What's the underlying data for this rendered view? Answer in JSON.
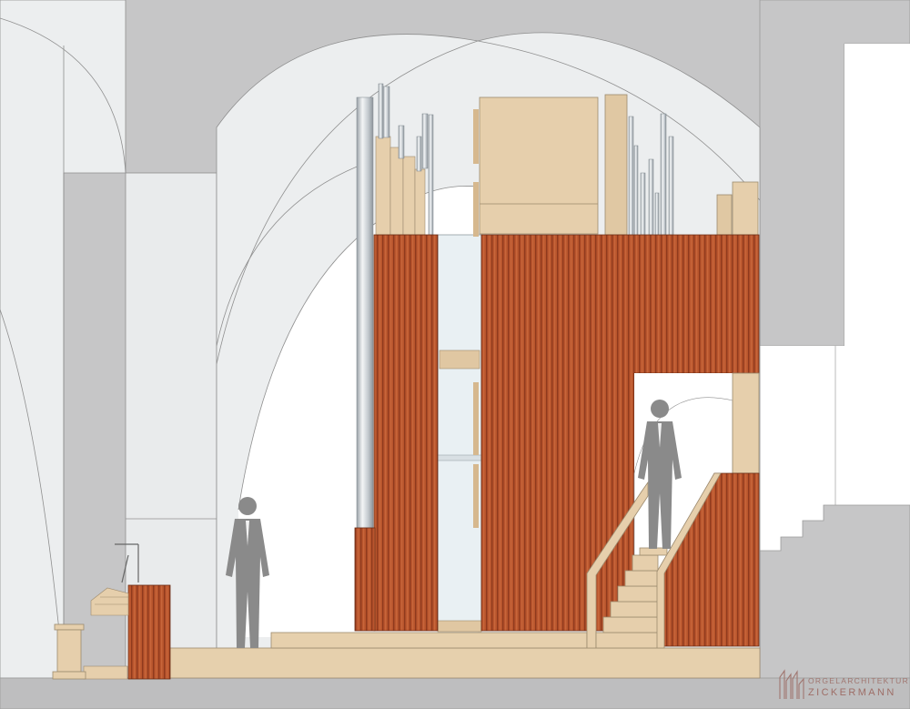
{
  "logo": {
    "line1": "ORGELARCHITEKTUR",
    "line2": "ZICKERMANN",
    "color": "#a07670"
  },
  "palette": {
    "vault_light": "#eef0f1",
    "wall_gray": "#c6c6c7",
    "floor_gray": "#bebebf",
    "wood": "#e2c8a3",
    "wood_dark": "#d6bb92",
    "slat_red": "#b8532b",
    "slat_dark": "#8e3a1c",
    "glass": "#eaf1f4",
    "pipe_steel": "#c9cfd4",
    "figure": "#8a8a8a"
  }
}
